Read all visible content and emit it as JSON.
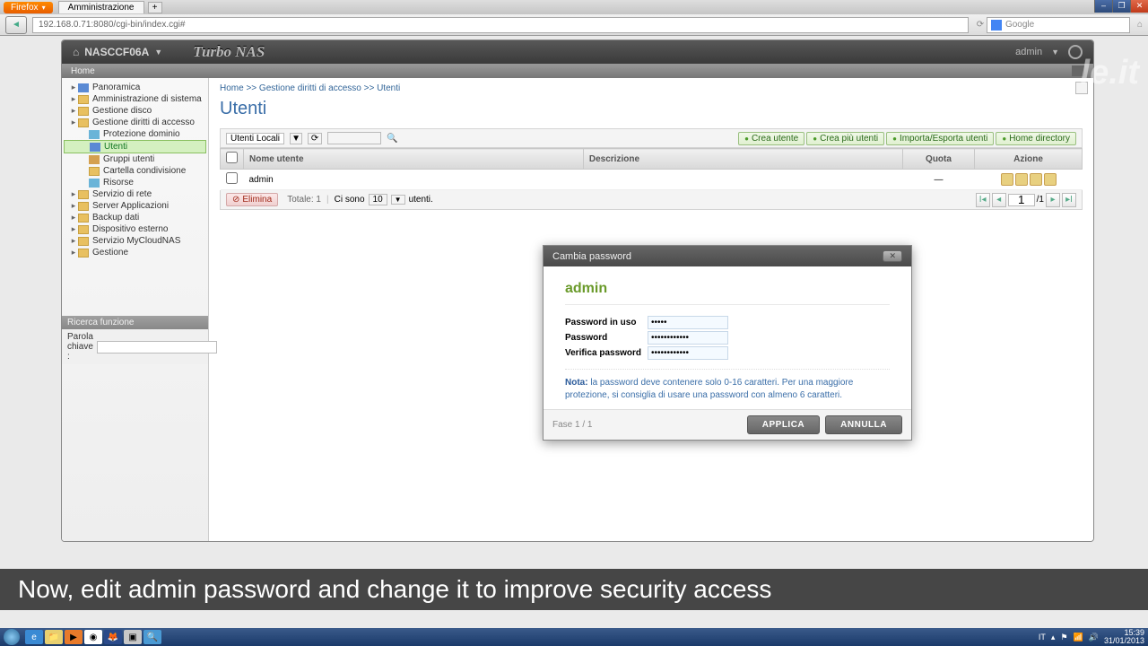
{
  "browser": {
    "name": "Firefox",
    "tab_title": "Amministrazione",
    "url": "192.168.0.71:8080/cgi-bin/index.cgi#",
    "search_placeholder": "Google"
  },
  "app": {
    "host": "NASCCF06A",
    "title": "Turbo NAS",
    "user": "admin",
    "sub_home": "Home",
    "breadcrumb": "Home >> Gestione diritti di accesso >> Utenti"
  },
  "sidebar": {
    "items": [
      {
        "label": "Panoramica",
        "lvl": 1,
        "ico": "dash"
      },
      {
        "label": "Amministrazione di sistema",
        "lvl": 1,
        "ico": "folder"
      },
      {
        "label": "Gestione disco",
        "lvl": 1,
        "ico": "folder"
      },
      {
        "label": "Gestione diritti di accesso",
        "lvl": 1,
        "ico": "folder"
      },
      {
        "label": "Protezione dominio",
        "lvl": 2,
        "ico": "shield"
      },
      {
        "label": "Utenti",
        "lvl": 2,
        "ico": "dash",
        "sel": true
      },
      {
        "label": "Gruppi utenti",
        "lvl": 2,
        "ico": "people"
      },
      {
        "label": "Cartella condivisione",
        "lvl": 2,
        "ico": "folder"
      },
      {
        "label": "Risorse",
        "lvl": 2,
        "ico": "shield"
      },
      {
        "label": "Servizio di rete",
        "lvl": 1,
        "ico": "folder"
      },
      {
        "label": "Server Applicazioni",
        "lvl": 1,
        "ico": "folder"
      },
      {
        "label": "Backup dati",
        "lvl": 1,
        "ico": "folder"
      },
      {
        "label": "Dispositivo esterno",
        "lvl": 1,
        "ico": "folder"
      },
      {
        "label": "Servizio MyCloudNAS",
        "lvl": 1,
        "ico": "folder"
      },
      {
        "label": "Gestione",
        "lvl": 1,
        "ico": "folder"
      }
    ],
    "search_header": "Ricerca funzione",
    "search_label": "Parola chiave :"
  },
  "page": {
    "title": "Utenti",
    "source": "Utenti Locali",
    "buttons": {
      "create": "Crea utente",
      "create_multi": "Crea più utenti",
      "import": "Importa/Esporta utenti",
      "home": "Home directory"
    },
    "columns": {
      "name": "Nome utente",
      "desc": "Descrizione",
      "quota": "Quota",
      "action": "Azione"
    },
    "row": {
      "name": "admin",
      "desc": "",
      "quota": "—"
    },
    "footer": {
      "delete": "Elimina",
      "total": "Totale: 1",
      "show": "Ci sono",
      "per": "10",
      "unit": "utenti.",
      "page": "1",
      "pages": "/1"
    }
  },
  "modal": {
    "title": "Cambia password",
    "user": "admin",
    "labels": {
      "old": "Password in uso",
      "new": "Password",
      "verify": "Verifica password"
    },
    "values": {
      "old": "•••••",
      "new": "••••••••••••",
      "verify": "••••••••••••"
    },
    "note_label": "Nota:",
    "note": "la password deve contenere solo 0-16 caratteri. Per una maggiore protezione, si consiglia di usare una password con almeno 6 caratteri.",
    "phase": "Fase 1 / 1",
    "apply": "APPLICA",
    "cancel": "ANNULLA"
  },
  "caption": "Now, edit admin password and change it to improve security access",
  "watermark": "le.it",
  "taskbar": {
    "lang": "IT",
    "time": "15:39",
    "date": "31/01/2013"
  }
}
